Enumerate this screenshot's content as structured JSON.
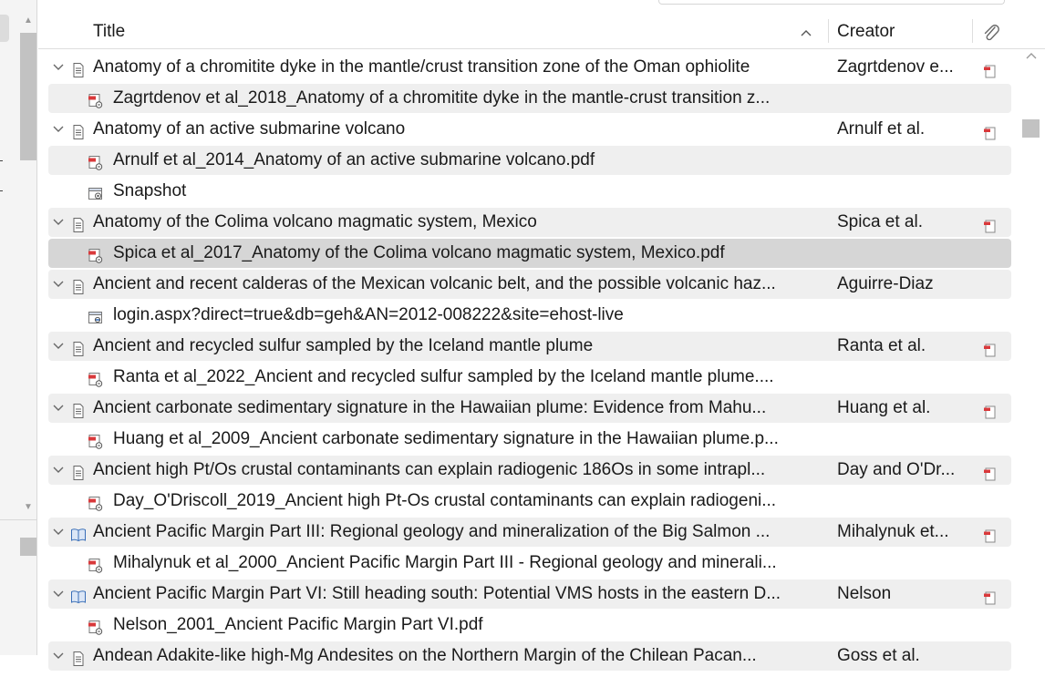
{
  "columns": {
    "title": "Title",
    "creator": "Creator",
    "sort_indicator": "^",
    "attachment_icon": "paperclip-icon"
  },
  "rows": [
    {
      "kind": "parent",
      "type": "document",
      "title": "Anatomy of a chromitite dyke in the mantle/crust transition zone of the Oman ophiolite",
      "creator": "Zagrtdenov e...",
      "has_pdf": true,
      "shaded": false
    },
    {
      "kind": "child",
      "type": "pdf",
      "title": "Zagrtdenov et al_2018_Anatomy of a chromitite dyke in the mantle-crust transition z...",
      "creator": "",
      "has_pdf": false,
      "shaded": true
    },
    {
      "kind": "parent",
      "type": "document",
      "title": "Anatomy of an active submarine volcano",
      "creator": "Arnulf et al.",
      "has_pdf": true,
      "shaded": false
    },
    {
      "kind": "child",
      "type": "pdf",
      "title": "Arnulf et al_2014_Anatomy of an active submarine volcano.pdf",
      "creator": "",
      "has_pdf": false,
      "shaded": true
    },
    {
      "kind": "child",
      "type": "snapshot",
      "title": "Snapshot",
      "creator": "",
      "has_pdf": false,
      "shaded": false
    },
    {
      "kind": "parent",
      "type": "document",
      "title": "Anatomy of the Colima volcano magmatic system, Mexico",
      "creator": "Spica et al.",
      "has_pdf": true,
      "shaded": true
    },
    {
      "kind": "child",
      "type": "pdf",
      "title": "Spica et al_2017_Anatomy of the Colima volcano magmatic system, Mexico.pdf",
      "creator": "",
      "has_pdf": false,
      "shaded": false,
      "selected": true
    },
    {
      "kind": "parent",
      "type": "document",
      "title": "Ancient and recent calderas of the Mexican volcanic belt, and the possible volcanic haz...",
      "creator": "Aguirre-Diaz",
      "has_pdf": false,
      "shaded": true
    },
    {
      "kind": "child",
      "type": "link",
      "title": "login.aspx?direct=true&db=geh&AN=2012-008222&site=ehost-live",
      "creator": "",
      "has_pdf": false,
      "shaded": false
    },
    {
      "kind": "parent",
      "type": "document",
      "title": "Ancient and recycled sulfur sampled by the Iceland mantle plume",
      "creator": "Ranta et al.",
      "has_pdf": true,
      "shaded": true
    },
    {
      "kind": "child",
      "type": "pdf",
      "title": "Ranta et al_2022_Ancient and recycled sulfur sampled by the Iceland mantle plume....",
      "creator": "",
      "has_pdf": false,
      "shaded": false
    },
    {
      "kind": "parent",
      "type": "document",
      "title": "Ancient carbonate sedimentary signature in the Hawaiian plume: Evidence from Mahu...",
      "creator": "Huang et al.",
      "has_pdf": true,
      "shaded": true
    },
    {
      "kind": "child",
      "type": "pdf",
      "title": "Huang et al_2009_Ancient carbonate sedimentary signature in the Hawaiian plume.p...",
      "creator": "",
      "has_pdf": false,
      "shaded": false
    },
    {
      "kind": "parent",
      "type": "document",
      "title": "Ancient high Pt/Os crustal contaminants can explain radiogenic 186Os in some intrapl...",
      "creator": "Day and O'Dr...",
      "has_pdf": true,
      "shaded": true
    },
    {
      "kind": "child",
      "type": "pdf",
      "title": "Day_O'Driscoll_2019_Ancient high Pt-Os crustal contaminants can explain radiogeni...",
      "creator": "",
      "has_pdf": false,
      "shaded": false
    },
    {
      "kind": "parent",
      "type": "book",
      "title": "Ancient Pacific Margin Part III: Regional geology and mineralization of the Big Salmon ...",
      "creator": "Mihalynuk et...",
      "has_pdf": true,
      "shaded": true
    },
    {
      "kind": "child",
      "type": "pdf",
      "title": "Mihalynuk et al_2000_Ancient Pacific Margin Part III - Regional geology and minerali...",
      "creator": "",
      "has_pdf": false,
      "shaded": false
    },
    {
      "kind": "parent",
      "type": "book",
      "title": "Ancient Pacific Margin Part VI: Still heading south: Potential VMS hosts in the eastern D...",
      "creator": "Nelson",
      "has_pdf": true,
      "shaded": true
    },
    {
      "kind": "child",
      "type": "pdf",
      "title": "Nelson_2001_Ancient Pacific Margin Part VI.pdf",
      "creator": "",
      "has_pdf": false,
      "shaded": false
    },
    {
      "kind": "parent",
      "type": "document",
      "title": "Andean Adakite-like high-Mg Andesites on the Northern Margin of the Chilean Pacan...",
      "creator": "Goss et al.",
      "has_pdf": false,
      "shaded": true
    }
  ]
}
